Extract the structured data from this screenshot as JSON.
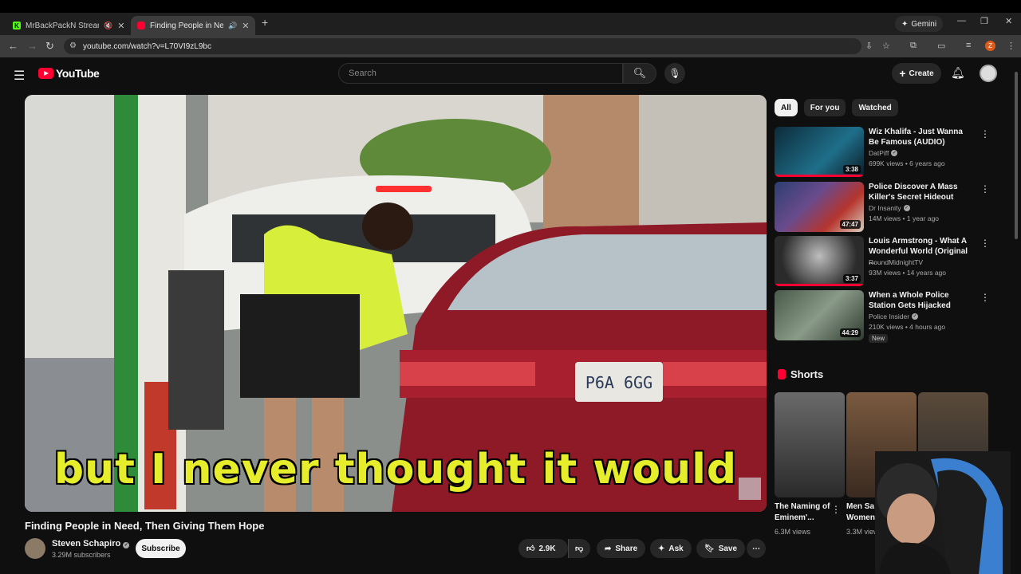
{
  "browser": {
    "tabs": [
      {
        "title": "MrBackPackN Stream - Wa",
        "favicon": "kick-icon",
        "active": false
      },
      {
        "title": "Finding People in Need, The",
        "favicon": "youtube-icon",
        "active": true
      }
    ],
    "gemini_label": "Gemini",
    "url": "youtube.com/watch?v=L70VI9zL9bc",
    "profile_initial": "Z"
  },
  "youtube": {
    "logo_text": "YouTube",
    "search_placeholder": "Search",
    "create_label": "Create"
  },
  "video": {
    "caption": "but I never thought it would",
    "title": "Finding People in Need, Then Giving Them Hope",
    "channel": "Steven Schapiro",
    "subscribers": "3.29M subscribers",
    "subscribe_label": "Subscribe",
    "likes": "2.9K",
    "share_label": "Share",
    "ask_label": "Ask",
    "save_label": "Save",
    "plate_text": "P6A 6GG"
  },
  "sidebar": {
    "chips": [
      "All",
      "For you",
      "Watched"
    ],
    "recommendations": [
      {
        "title": "Wiz Khalifa - Just Wanna Be Famous (AUDIO)",
        "channel": "DatPiff",
        "verified": true,
        "meta": "699K views • 6 years ago",
        "duration": "3:38",
        "progress": 1.0
      },
      {
        "title": "Police Discover A Mass Killer's Secret Hideout",
        "channel": "Dr Insanity",
        "verified": true,
        "meta": "14M views • 1 year ago",
        "duration": "47:47",
        "progress": 0
      },
      {
        "title": "Louis Armstrong - What A Wonderful World (Original ...",
        "channel": "RoundMidnightTV",
        "verified": false,
        "meta": "93M views • 14 years ago",
        "duration": "3:37",
        "progress": 1.0
      },
      {
        "title": "When a Whole Police Station Gets Hijacked",
        "channel": "Police Insider",
        "verified": true,
        "meta": "210K views • 4 hours ago",
        "duration": "44:29",
        "progress": 0
      }
    ],
    "new_badge": "New",
    "shorts_header": "Shorts",
    "shorts": [
      {
        "title": "The Naming of Eminem'...",
        "views": "6.3M views"
      },
      {
        "title": "Men Sa Women",
        "views": "3.3M view"
      }
    ]
  }
}
